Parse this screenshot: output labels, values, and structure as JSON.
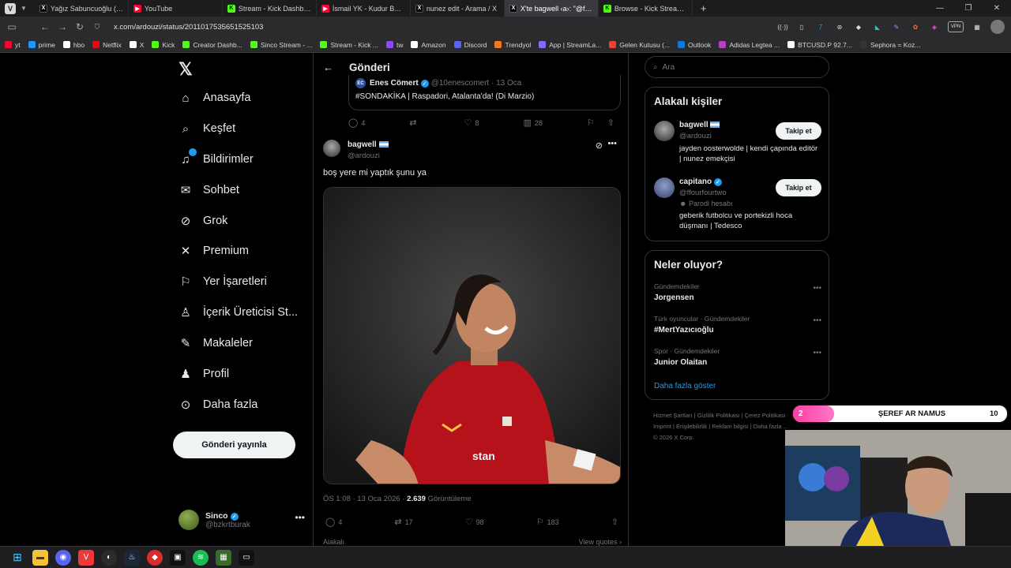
{
  "browser": {
    "tabs": [
      {
        "label": "Yağız Sabuncuoğlu (@yagoo",
        "icon": "x-icon",
        "active": false
      },
      {
        "label": "YouTube",
        "icon": "youtube-icon",
        "active": false
      },
      {
        "label": "Stream - Kick Dashboard",
        "icon": "kick-icon",
        "active": false
      },
      {
        "label": "İsmail YK - Kudur Baby ( Uz",
        "icon": "youtube-icon",
        "active": false
      },
      {
        "label": "nunez edit - Arama / X",
        "icon": "x-icon",
        "active": false
      },
      {
        "label": "X'te bagwell ‹a›: \"@ffourfou",
        "icon": "x-icon",
        "active": true
      },
      {
        "label": "Browse - Kick Streaming",
        "icon": "kick-icon",
        "active": false
      }
    ],
    "url": "x.com/ardouzi/status/2011017535651525103",
    "bookmarks": [
      {
        "label": "yt",
        "color": "#ff0033"
      },
      {
        "label": "prime",
        "color": "#1a98ff"
      },
      {
        "label": "hbo",
        "color": "#ffffff"
      },
      {
        "label": "Netflix",
        "color": "#e50914"
      },
      {
        "label": "X",
        "color": "#ffffff"
      },
      {
        "label": "Kick",
        "color": "#53fc18"
      },
      {
        "label": "Creator Dashb...",
        "color": "#53fc18"
      },
      {
        "label": "Sinco Stream - ...",
        "color": "#53fc18"
      },
      {
        "label": "Stream - Kick ...",
        "color": "#53fc18"
      },
      {
        "label": "tw",
        "color": "#9146ff"
      },
      {
        "label": "Amazon",
        "color": "#ffffff"
      },
      {
        "label": "Discord",
        "color": "#5865f2"
      },
      {
        "label": "Trendyol",
        "color": "#f27a1a"
      },
      {
        "label": "App | StreamLa...",
        "color": "#7c6cff"
      },
      {
        "label": "Gelen Kutusu (...",
        "color": "#ea4335"
      },
      {
        "label": "Outlook",
        "color": "#0f78d4"
      },
      {
        "label": "Adidas Legtea ...",
        "color": "#b43fbf"
      },
      {
        "label": "BTCUSD.P 92.7...",
        "color": "#ffffff"
      },
      {
        "label": "Sephora = Koz...",
        "color": "#333333"
      }
    ]
  },
  "nav": {
    "items": [
      {
        "label": "Anasayfa",
        "icon": "home-icon"
      },
      {
        "label": "Keşfet",
        "icon": "search-icon"
      },
      {
        "label": "Bildirimler",
        "icon": "bell-icon"
      },
      {
        "label": "Sohbet",
        "icon": "mail-icon"
      },
      {
        "label": "Grok",
        "icon": "grok-icon"
      },
      {
        "label": "Premium",
        "icon": "x-premium-icon"
      },
      {
        "label": "Yer İşaretleri",
        "icon": "bookmark-icon"
      },
      {
        "label": "İçerik Üreticisi St...",
        "icon": "creator-icon"
      },
      {
        "label": "Makaleler",
        "icon": "article-icon"
      },
      {
        "label": "Profil",
        "icon": "profile-icon"
      },
      {
        "label": "Daha fazla",
        "icon": "more-icon"
      }
    ],
    "post_button": "Gönderi yayınla",
    "me": {
      "name": "Sinco",
      "handle": "@bzkrtburak"
    }
  },
  "main": {
    "title": "Gönderi",
    "quote": {
      "name": "Enes Cömert",
      "handle": "@10enescomert",
      "dot": "·",
      "date": "13 Oca",
      "text": "#SONDAKİKA | Raspadori, Atalanta'da! (Di Marzio)"
    },
    "parent_actions": {
      "replies": "4",
      "retweets": "",
      "likes": "8",
      "views": "28"
    },
    "tweet": {
      "name": "bagwell",
      "handle": "@ardouzi",
      "text": "boş yere mi yaptık şunu ya",
      "timestamp": "ÖS 1:08 · 13 Oca 2026 ·",
      "views": "2.639",
      "views_label": "Görüntüleme"
    },
    "tweet_actions": {
      "replies": "4",
      "retweets": "17",
      "likes": "98",
      "bookmarks": "183"
    },
    "cutoff_left": "Alakalı",
    "cutoff_right": "View quotes ›"
  },
  "right": {
    "search_placeholder": "Ara",
    "relevant_title": "Alakalı kişiler",
    "people": [
      {
        "name": "bagwell",
        "handle": "@ardouzi",
        "bio": "jayden oosterwolde | kendi çapında editör | nunez emekçisi",
        "follow": "Takip et"
      },
      {
        "name": "capitano",
        "handle": "@ffourfourtwo",
        "parody": "Parodi hesabı",
        "bio": "geberik futbolcu ve portekizli hoca düşmanı | Tedesco",
        "follow": "Takip et"
      }
    ],
    "trends_title": "Neler oluyor?",
    "trends": [
      {
        "category": "Gündemdekiler",
        "name": "Jorgensen"
      },
      {
        "category": "Türk oyuncular · Gündemdekiler",
        "name": "#MertYazıcıoğlu"
      },
      {
        "category": "Spor · Gündemdekiler",
        "name": "Junior Olaitan"
      }
    ],
    "show_more": "Daha fazla göster",
    "footer": [
      "Hizmet Şartları",
      "Gizlilik Politikası",
      "Çerez Politikası",
      "Imprint",
      "Erişilebilirlik",
      "Reklam bilgisi",
      "Daha fazla ...",
      "© 2026 X Corp."
    ]
  },
  "overlay": {
    "left": "2",
    "label": "ŞEREF AR NAMUS",
    "right": "10"
  },
  "colors": {
    "accent": "#1d9bf0",
    "background": "#000000",
    "kick": "#53fc18"
  }
}
